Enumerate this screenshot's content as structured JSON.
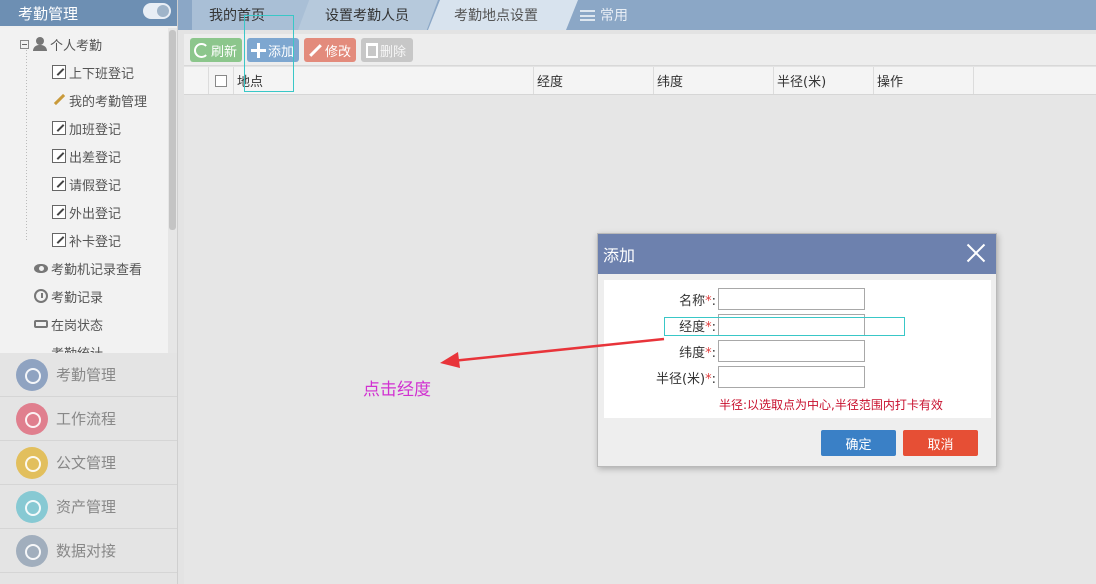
{
  "sidebar": {
    "title": "考勤管理",
    "group_label": "个人考勤",
    "items": [
      {
        "label": "上下班登记",
        "icon": "edit-icon"
      },
      {
        "label": "我的考勤管理",
        "icon": "pencil-icon"
      },
      {
        "label": "加班登记",
        "icon": "edit-icon"
      },
      {
        "label": "出差登记",
        "icon": "edit-icon"
      },
      {
        "label": "请假登记",
        "icon": "edit-icon"
      },
      {
        "label": "外出登记",
        "icon": "edit-icon"
      },
      {
        "label": "补卡登记",
        "icon": "edit-icon"
      }
    ],
    "top_items": [
      {
        "label": "考勤机记录查看",
        "icon": "eye-icon"
      },
      {
        "label": "考勤记录",
        "icon": "clock-icon"
      },
      {
        "label": "在岗状态",
        "icon": "card-icon"
      },
      {
        "label": "考勤统计",
        "icon": "chart-icon"
      }
    ],
    "modules": [
      {
        "label": "考勤管理",
        "color": "#8fa3c1",
        "icon": "clock-icon"
      },
      {
        "label": "工作流程",
        "color": "#e07f8e",
        "icon": "flow-icon"
      },
      {
        "label": "公文管理",
        "color": "#e2bf5d",
        "icon": "document-icon"
      },
      {
        "label": "资产管理",
        "color": "#87c9d3",
        "icon": "briefcase-icon"
      },
      {
        "label": "数据对接",
        "color": "#a1aebd",
        "icon": "plug-icon"
      }
    ]
  },
  "tabs": [
    {
      "label": "我的首页"
    },
    {
      "label": "设置考勤人员"
    },
    {
      "label": "考勤地点设置"
    },
    {
      "label": "常用"
    }
  ],
  "toolbar": {
    "refresh": "刷新",
    "add": "添加",
    "edit": "修改",
    "delete": "删除"
  },
  "table": {
    "columns": [
      "地点",
      "经度",
      "纬度",
      "半径(米)",
      "操作"
    ]
  },
  "dialog": {
    "title": "添加",
    "fields": [
      {
        "label": "名称",
        "value": ""
      },
      {
        "label": "经度",
        "value": ""
      },
      {
        "label": "纬度",
        "value": ""
      },
      {
        "label": "半径(米)",
        "value": ""
      }
    ],
    "required_mark": "*",
    "colon": ":",
    "hint": "半径:以选取点为中心,半径范围内打卡有效",
    "ok": "确定",
    "cancel": "取消"
  },
  "annotation": {
    "text": "点击经度",
    "color": "#d130d1",
    "arrow_color": "#e8343a"
  },
  "colors": {
    "tab_bar": "#8ba7c6",
    "dialog_header": "#6d81ae",
    "ok_button": "#3a80c6",
    "cancel_button": "#e64f35"
  }
}
